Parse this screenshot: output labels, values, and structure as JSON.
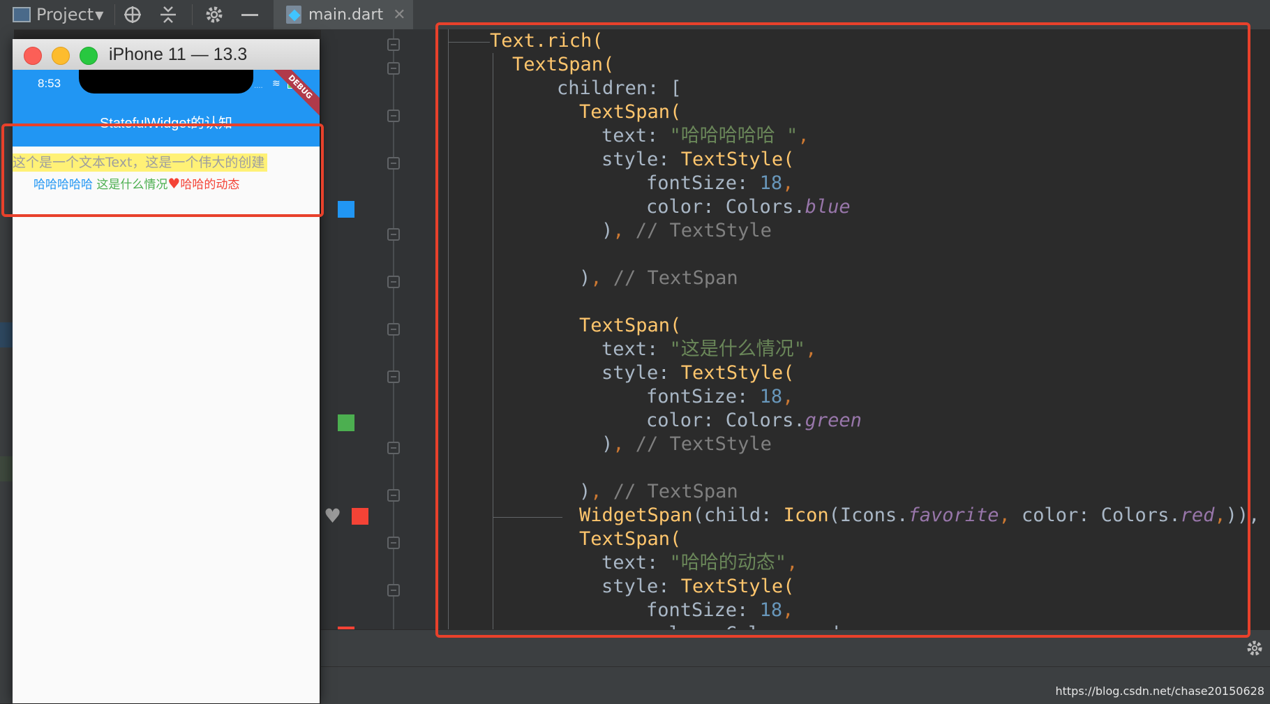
{
  "toolbar": {
    "project_label": "Project",
    "file_tab_label": "main.dart"
  },
  "simulator": {
    "window_title": "iPhone 11 — 13.3",
    "status_time": "8:53",
    "debug_banner": "DEBUG",
    "app_title": "StatefulWidget的认知",
    "text_line": "这个是一个文本Text，这是一个伟大的创建",
    "rich_spans": [
      {
        "text": "哈哈哈哈哈 ",
        "color": "#2196f3"
      },
      {
        "text": "这是什么情况",
        "color": "#4caf50"
      },
      {
        "icon": "favorite-icon",
        "color": "#f44336"
      },
      {
        "text": "哈哈的动态",
        "color": "#f44336"
      }
    ]
  },
  "code": {
    "l1_a": "Text.rich(",
    "l2_a": "TextSpan(",
    "l3_a": "children: [",
    "l4_a": "TextSpan(",
    "l5_a": "text: ",
    "l5_b": "\"哈哈哈哈哈 \"",
    "l5_c": ",",
    "l6_a": "style: ",
    "l6_b": "TextStyle(",
    "l7_a": "fontSize: ",
    "l7_b": "18",
    "l7_c": ",",
    "l8_a": "color: Colors.",
    "l8_b": "blue",
    "l9_a": ")",
    "l9_b": ", ",
    "l9_c": "// TextStyle",
    "l10_a": ")",
    "l10_b": ", ",
    "l10_c": "// TextSpan",
    "l11_a": "TextSpan(",
    "l12_a": "text: ",
    "l12_b": "\"这是什么情况\"",
    "l12_c": ",",
    "l13_a": "style: ",
    "l13_b": "TextStyle(",
    "l14_a": "fontSize: ",
    "l14_b": "18",
    "l14_c": ",",
    "l15_a": "color: Colors.",
    "l15_b": "green",
    "l16_a": ")",
    "l16_b": ", ",
    "l16_c": "// TextStyle",
    "l17_a": ")",
    "l17_b": ", ",
    "l17_c": "// TextSpan",
    "l18_a": "WidgetSpan",
    "l18_b": "(child: ",
    "l18_c": "Icon",
    "l18_d": "(Icons.",
    "l18_e": "favorite",
    "l18_f": ", ",
    "l18_g": "color: Colors.",
    "l18_h": "red",
    "l18_i": ",",
    "l18_j": ")),",
    "l19_a": "TextSpan(",
    "l20_a": "text: ",
    "l20_b": "\"哈哈的动态\"",
    "l20_c": ",",
    "l21_a": "style: ",
    "l21_b": "TextStyle(",
    "l22_a": "fontSize: ",
    "l22_b": "18",
    "l22_c": ",",
    "l23_a": "color: Colors.red"
  },
  "gutter_swatches": [
    "#2196f3",
    "#4caf50",
    "#f44336"
  ],
  "watermark": "https://blog.csdn.net/chase20150628"
}
